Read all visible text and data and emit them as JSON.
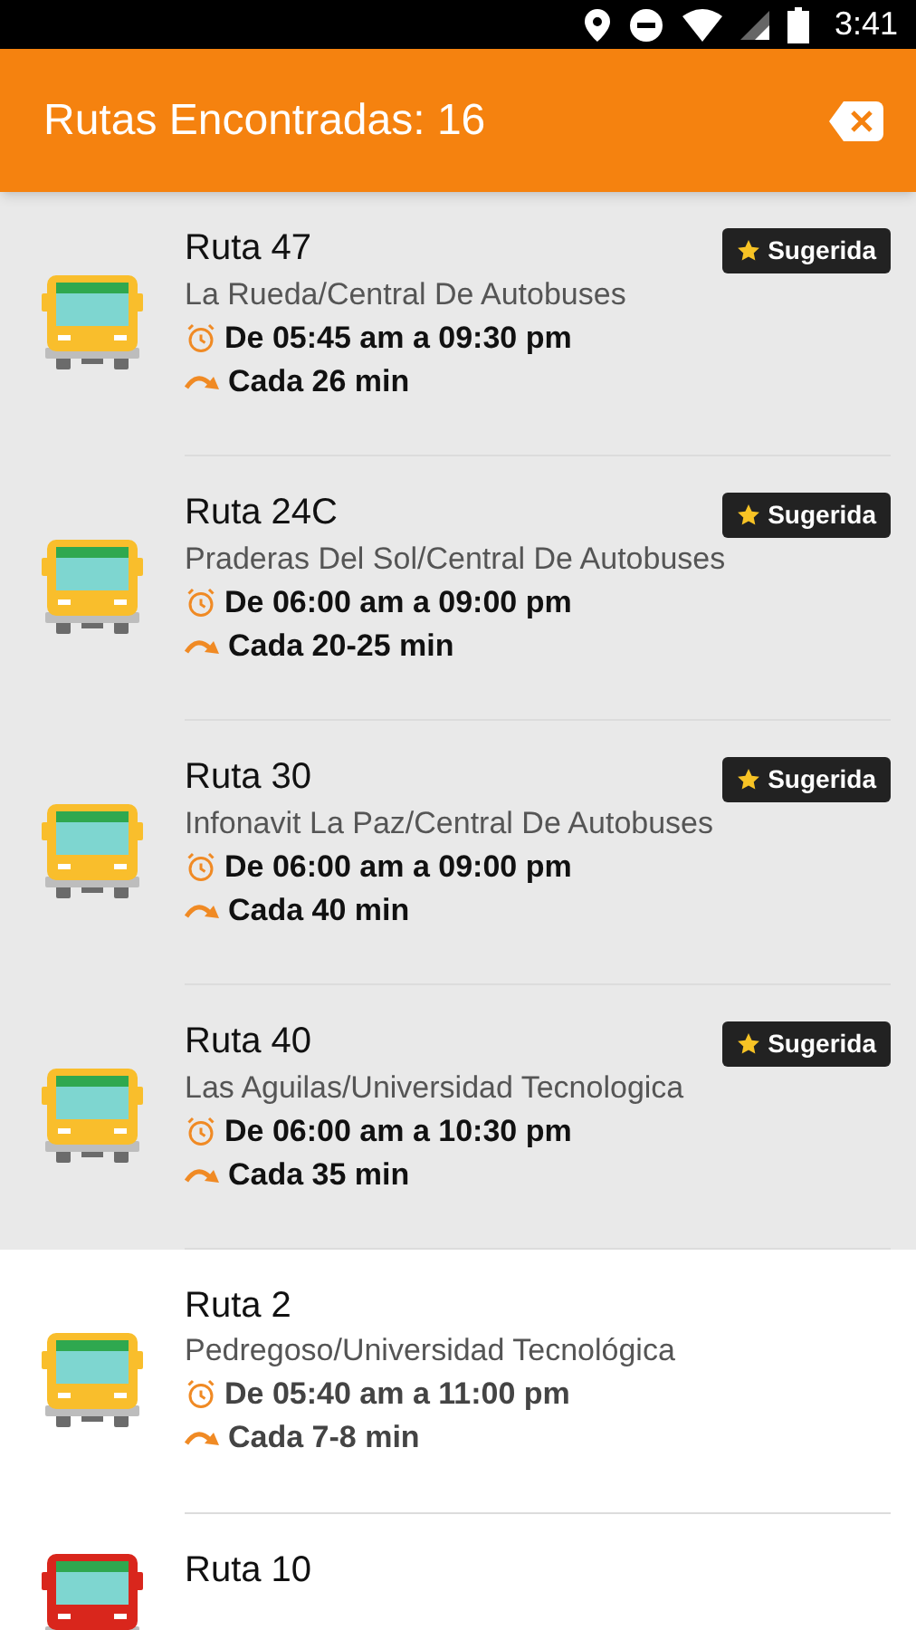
{
  "status_bar": {
    "time": "3:41"
  },
  "header": {
    "title": "Rutas Encontradas: 16"
  },
  "routes": [
    {
      "name": "Ruta 47",
      "path": "La Rueda/Central De Autobuses",
      "hours": "De 05:45 am a 09:30 pm",
      "frequency": "Cada 26 min",
      "suggested": true,
      "badge": "Sugerida",
      "color": "#f9be2c"
    },
    {
      "name": "Ruta 24C",
      "path": "Praderas Del Sol/Central De Autobuses",
      "hours": "De 06:00 am a 09:00 pm",
      "frequency": "Cada 20-25 min",
      "suggested": true,
      "badge": "Sugerida",
      "color": "#f9be2c"
    },
    {
      "name": "Ruta 30",
      "path": "Infonavit La Paz/Central De Autobuses",
      "hours": "De 06:00 am a 09:00 pm",
      "frequency": "Cada 40 min",
      "suggested": true,
      "badge": "Sugerida",
      "color": "#f9be2c"
    },
    {
      "name": "Ruta 40",
      "path": "Las Aguilas/Universidad Tecnologica",
      "hours": "De 06:00 am a 10:30 pm",
      "frequency": "Cada 35 min",
      "suggested": true,
      "badge": "Sugerida",
      "color": "#f9be2c"
    },
    {
      "name": "Ruta 2",
      "path": "Pedregoso/Universidad Tecnológica",
      "hours": "De 05:40 am a 11:00 pm",
      "frequency": "Cada 7-8 min",
      "suggested": false,
      "color": "#f9be2c"
    },
    {
      "name": "Ruta 10",
      "suggested": false,
      "color": "#d9261c"
    }
  ]
}
